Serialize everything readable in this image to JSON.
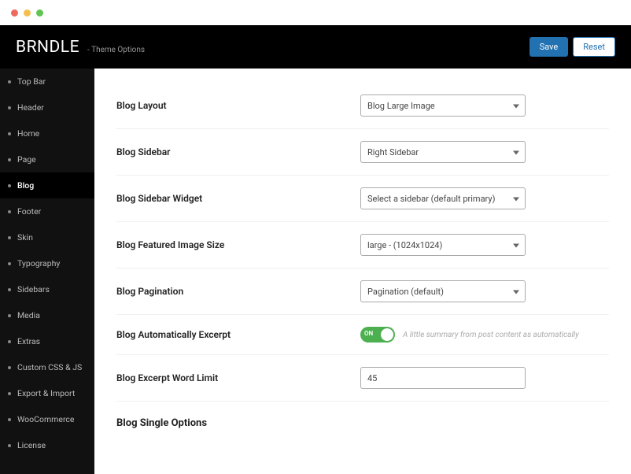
{
  "header": {
    "brand": "BRNDLE",
    "subtitle": "- Theme Options",
    "save": "Save",
    "reset": "Reset"
  },
  "sidebar": {
    "items": [
      "Top Bar",
      "Header",
      "Home",
      "Page",
      "Blog",
      "Footer",
      "Skin",
      "Typography",
      "Sidebars",
      "Media",
      "Extras",
      "Custom CSS & JS",
      "Export & Import",
      "WooCommerce",
      "License"
    ],
    "active_index": 4
  },
  "fields": {
    "layout": {
      "label": "Blog Layout",
      "value": "Blog Large Image"
    },
    "sidebar": {
      "label": "Blog Sidebar",
      "value": "Right Sidebar"
    },
    "widget": {
      "label": "Blog Sidebar Widget",
      "value": "Select a sidebar (default primary)"
    },
    "img_size": {
      "label": "Blog Featured Image Size",
      "value": "large - (1024x1024)"
    },
    "pagination": {
      "label": "Blog Pagination",
      "value": "Pagination (default)"
    },
    "auto_excerpt": {
      "label": "Blog Automatically Excerpt",
      "toggle_text": "ON",
      "desc": "A little summary from post content as automatically"
    },
    "excerpt_limit": {
      "label": "Blog Excerpt Word Limit",
      "value": "45"
    }
  },
  "section": {
    "single": "Blog Single Options"
  }
}
